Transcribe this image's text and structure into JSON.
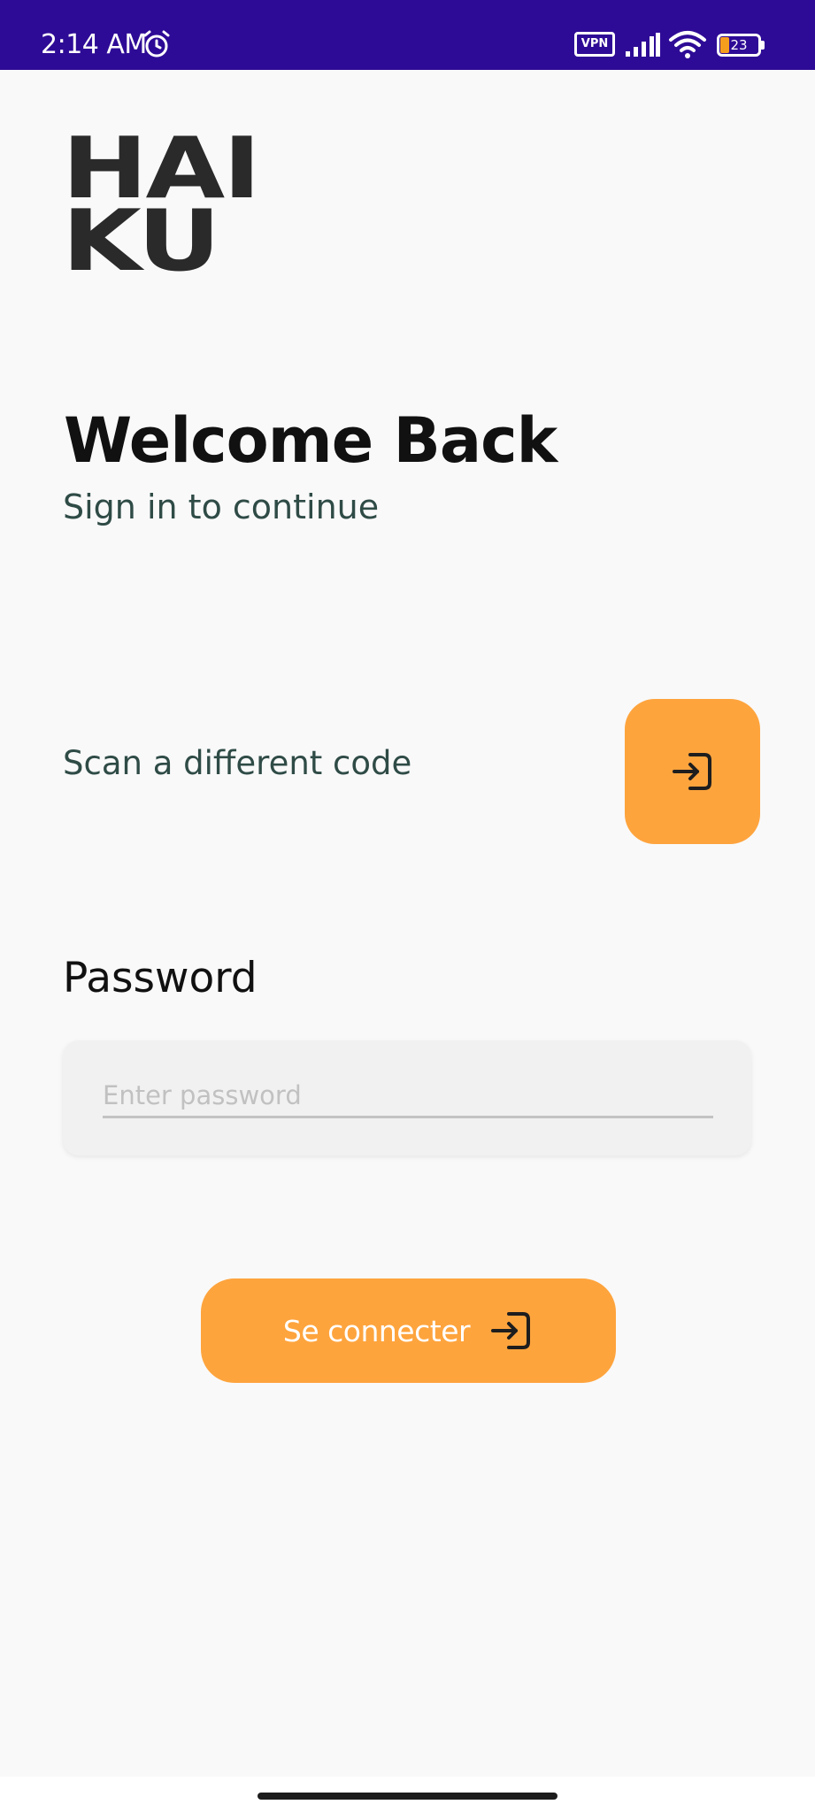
{
  "status_bar": {
    "time": "2:14 AM",
    "vpn_label": "VPN",
    "battery_level": "23",
    "battery_fraction": 0.23,
    "background_color": "#2e0b96",
    "icons": [
      "alarm-icon",
      "vpn-icon",
      "signal-icon",
      "wifi-icon",
      "battery-icon"
    ]
  },
  "logo": {
    "line1": "HAI",
    "line2": "KU"
  },
  "header": {
    "title": "Welcome Back",
    "subtitle": "Sign in to continue"
  },
  "scan": {
    "label": "Scan a different code",
    "button_icon": "login-icon"
  },
  "password": {
    "label": "Password",
    "placeholder": "Enter password",
    "value": ""
  },
  "connect_button": {
    "label": "Se connecter",
    "icon": "login-icon"
  },
  "colors": {
    "accent": "#fea43d",
    "background": "#f9f9f9",
    "subtitle_text": "#2f4b46"
  }
}
